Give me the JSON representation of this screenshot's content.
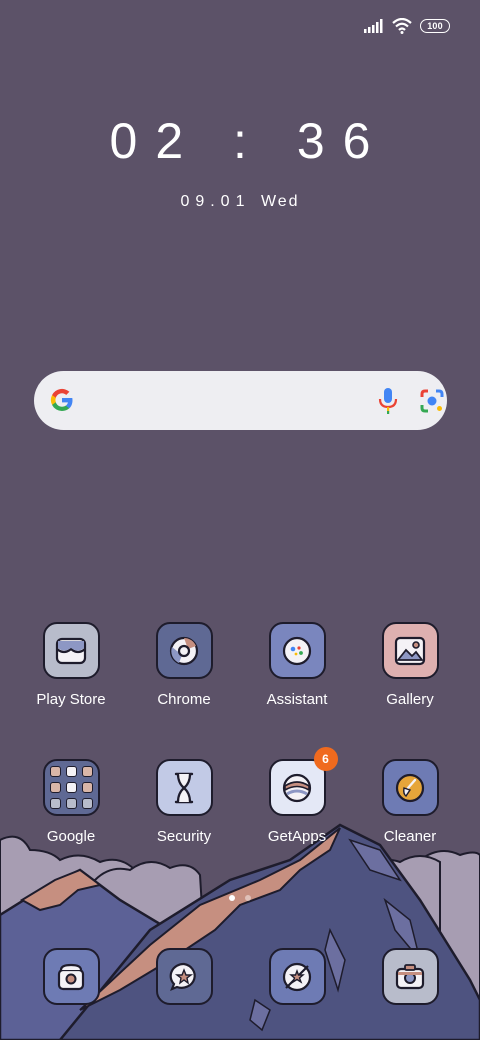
{
  "status_bar": {
    "signal_icon": "cell-signal-icon",
    "wifi_icon": "wifi-icon",
    "battery_level": "100"
  },
  "clock": {
    "time": "02 : 36",
    "date": "09.01",
    "weekday": "Wed"
  },
  "search": {
    "logo_icon": "google-g-icon",
    "mic_icon": "microphone-icon",
    "lens_icon": "lens-camera-icon"
  },
  "apps": [
    {
      "label": "Play Store",
      "icon": "play-store-icon",
      "color": "#b8bccb"
    },
    {
      "label": "Chrome",
      "icon": "chrome-icon",
      "color": "#5f6994"
    },
    {
      "label": "Assistant",
      "icon": "assistant-icon",
      "color": "#7a86be"
    },
    {
      "label": "Gallery",
      "icon": "gallery-icon",
      "color": "#deb0b0"
    },
    {
      "label": "Google",
      "icon": "folder-icon",
      "color": "#5f6994"
    },
    {
      "label": "Security",
      "icon": "hourglass-icon",
      "color": "#c2cae6"
    },
    {
      "label": "GetApps",
      "icon": "getapps-icon",
      "color": "#e4e8f6",
      "badge": "6"
    },
    {
      "label": "Cleaner",
      "icon": "broom-icon",
      "color": "#6e7bb4"
    }
  ],
  "dock": [
    {
      "icon": "phone-icon",
      "color": "#6e7bb4"
    },
    {
      "icon": "messages-icon",
      "color": "#5f6994"
    },
    {
      "icon": "browser-icon",
      "color": "#6e7bb4"
    },
    {
      "icon": "camera-icon",
      "color": "#b8bccb"
    }
  ],
  "page_indicator": {
    "pages": 2,
    "current": 1
  }
}
